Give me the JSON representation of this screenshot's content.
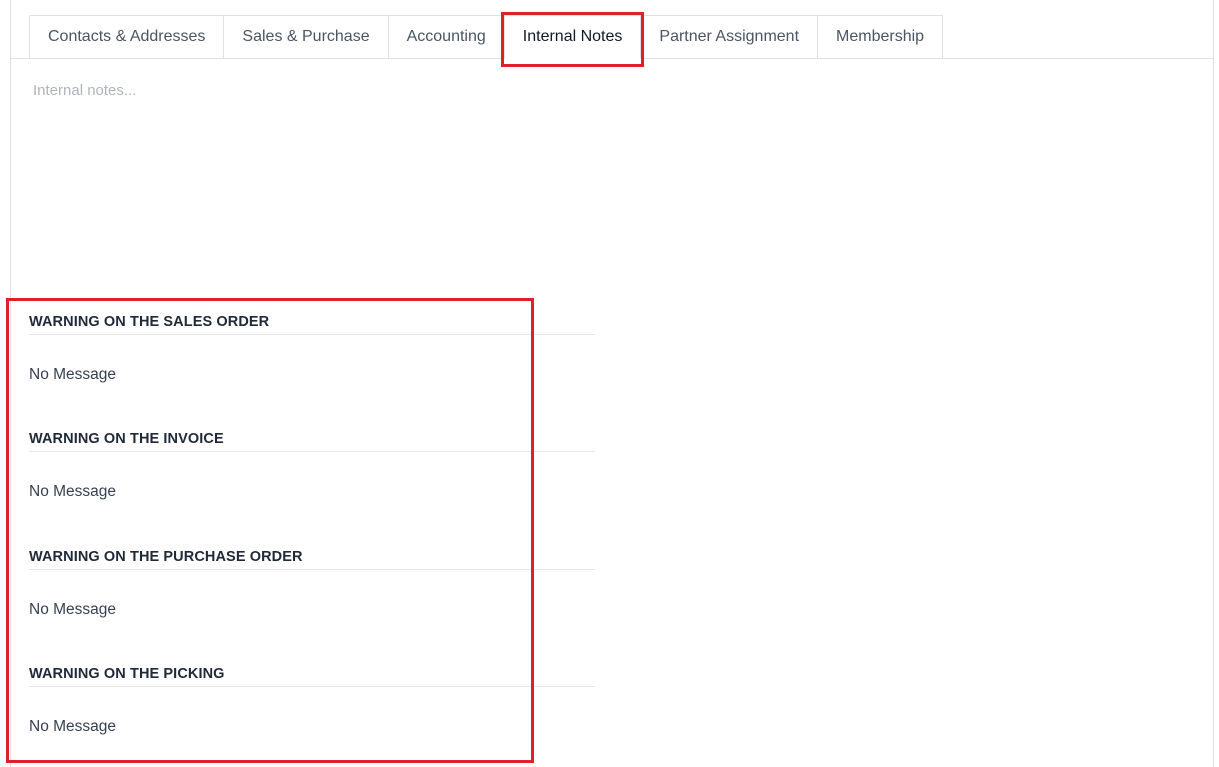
{
  "tabs": [
    {
      "label": "Contacts & Addresses",
      "active": false
    },
    {
      "label": "Sales & Purchase",
      "active": false
    },
    {
      "label": "Accounting",
      "active": false
    },
    {
      "label": "Internal Notes",
      "active": true
    },
    {
      "label": "Partner Assignment",
      "active": false
    },
    {
      "label": "Membership",
      "active": false
    }
  ],
  "notes": {
    "placeholder": "Internal notes...",
    "value": ""
  },
  "warnings": [
    {
      "title": "WARNING ON THE SALES ORDER",
      "value": "No Message"
    },
    {
      "title": "WARNING ON THE INVOICE",
      "value": "No Message"
    },
    {
      "title": "WARNING ON THE PURCHASE ORDER",
      "value": "No Message"
    },
    {
      "title": "WARNING ON THE PICKING",
      "value": "No Message"
    }
  ],
  "colors": {
    "highlight": "#e02028",
    "border": "#dee2e6"
  }
}
